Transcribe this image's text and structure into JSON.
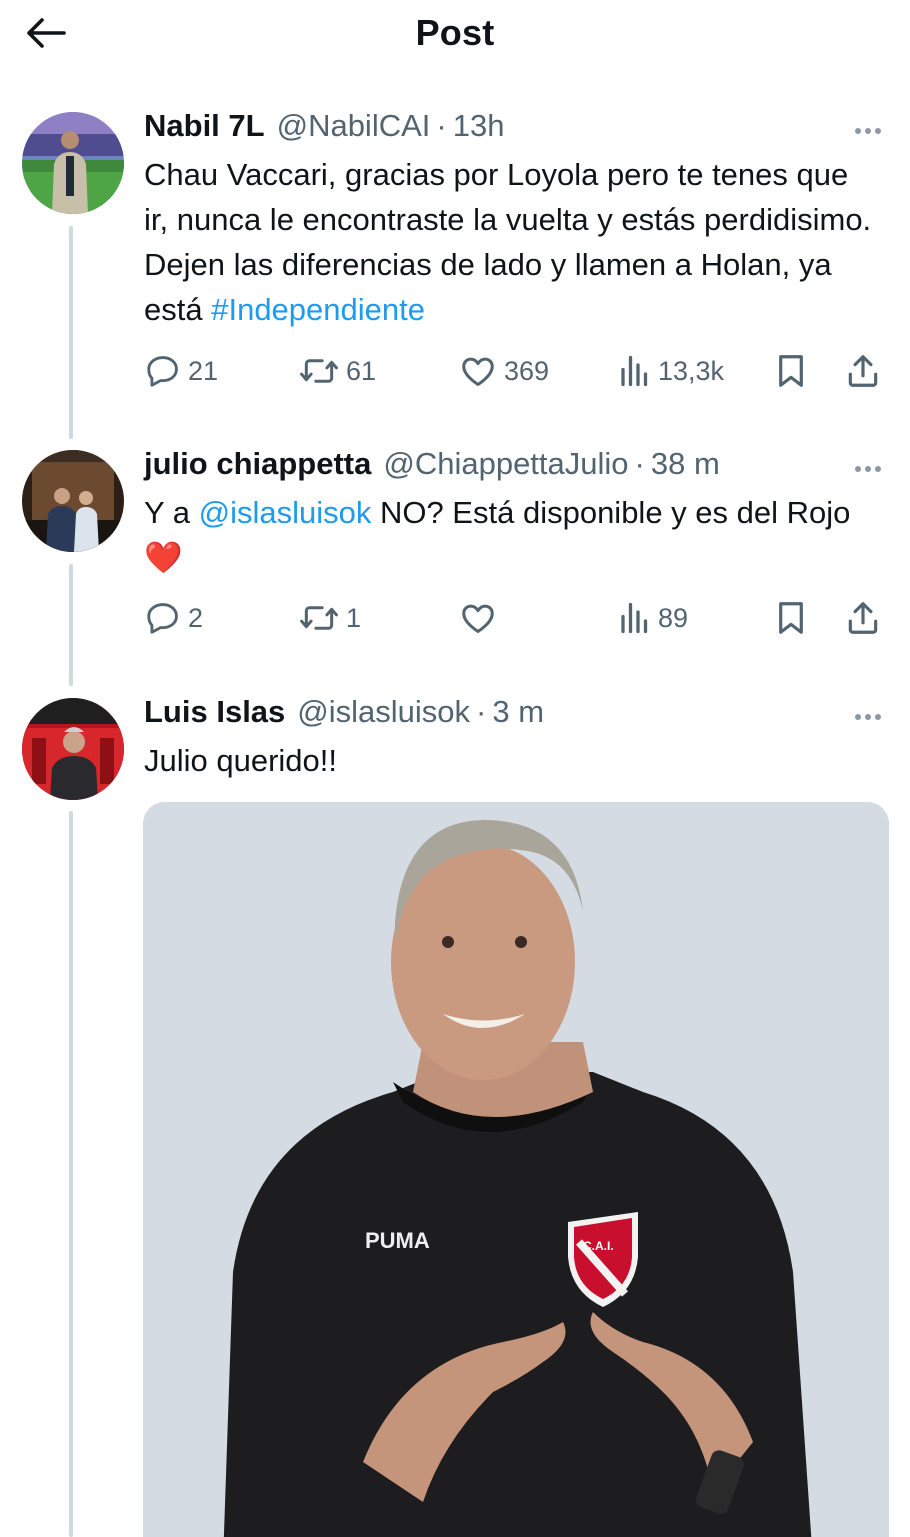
{
  "header": {
    "title": "Post"
  },
  "tweets": [
    {
      "name": "Nabil 7L",
      "handle": "@NabilCAI",
      "sep": "·",
      "time": "13h",
      "text_before": "Chau Vaccari, gracias por Loyola pero te tenes que ir, nunca le encontraste la vuelta y estás perdidisimo. Dejen las diferencias de lado y llamen a Holan, ya está ",
      "hashtag": "#Independiente",
      "replies": "21",
      "reposts": "61",
      "likes": "369",
      "views": "13,3k"
    },
    {
      "name": "julio chiappetta",
      "handle": "@ChiappettaJulio",
      "sep": "·",
      "time": "38 m",
      "text_before": "Y a ",
      "mention": "@islasluisok",
      "text_after": " NO? Está disponible y es del Rojo ❤️",
      "replies": "2",
      "reposts": "1",
      "likes": "",
      "views": "89"
    },
    {
      "name": "Luis Islas",
      "handle": "@islasluisok",
      "sep": "·",
      "time": "3 m",
      "text": "Julio querido!!",
      "photo_shirt_brand": "PUMA",
      "photo_crest": "C.A.I."
    }
  ],
  "colors": {
    "link": "#1d9bf0",
    "muted": "#536471",
    "thread": "#cfd9de",
    "heart": "#e0245e"
  },
  "icons": [
    "back-arrow-icon",
    "more-icon",
    "reply-icon",
    "repost-icon",
    "like-icon",
    "views-icon",
    "bookmark-icon",
    "share-icon"
  ]
}
